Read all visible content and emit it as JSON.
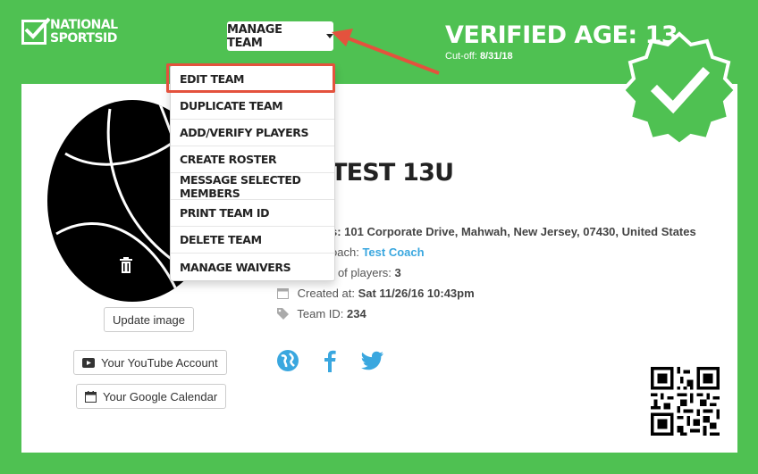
{
  "brand": {
    "line1": "NATIONAL",
    "line2": "SPORTSID",
    "accent": "#4fc152"
  },
  "toolbar": {
    "manage_team_label": "MANAGE TEAM"
  },
  "verification": {
    "title": "VERIFIED AGE: 13",
    "cutoff_label": "Cut-off:",
    "cutoff_value": "8/31/18",
    "badge_icon": "verified-badge-icon"
  },
  "dropdown": {
    "items": [
      "EDIT TEAM",
      "DUPLICATE TEAM",
      "ADD/VERIFY PLAYERS",
      "CREATE ROSTER",
      "MESSAGE SELECTED MEMBERS",
      "PRINT TEAM ID",
      "DELETE TEAM",
      "MANAGE WAIVERS"
    ],
    "highlight_color": "#e4523d"
  },
  "team": {
    "name": "TEST 13U",
    "address_value": "s: 101 Corporate Drive, Mahwah, New Jersey, 07430, United States",
    "coach_label": "oach:",
    "coach_value": "Test Coach",
    "players_label": "r of players:",
    "players_value": "3",
    "created_label": "Created at:",
    "created_value": "Sat 11/26/16 10:43pm",
    "team_id_label": "Team ID:",
    "team_id_value": "234"
  },
  "profile": {
    "update_image_label": "Update image",
    "youtube_label": "Your YouTube Account",
    "calendar_label": "Your Google Calendar"
  },
  "social": {
    "icons": [
      "globe-icon",
      "facebook-icon",
      "twitter-icon"
    ],
    "color": "#3aa7df"
  }
}
